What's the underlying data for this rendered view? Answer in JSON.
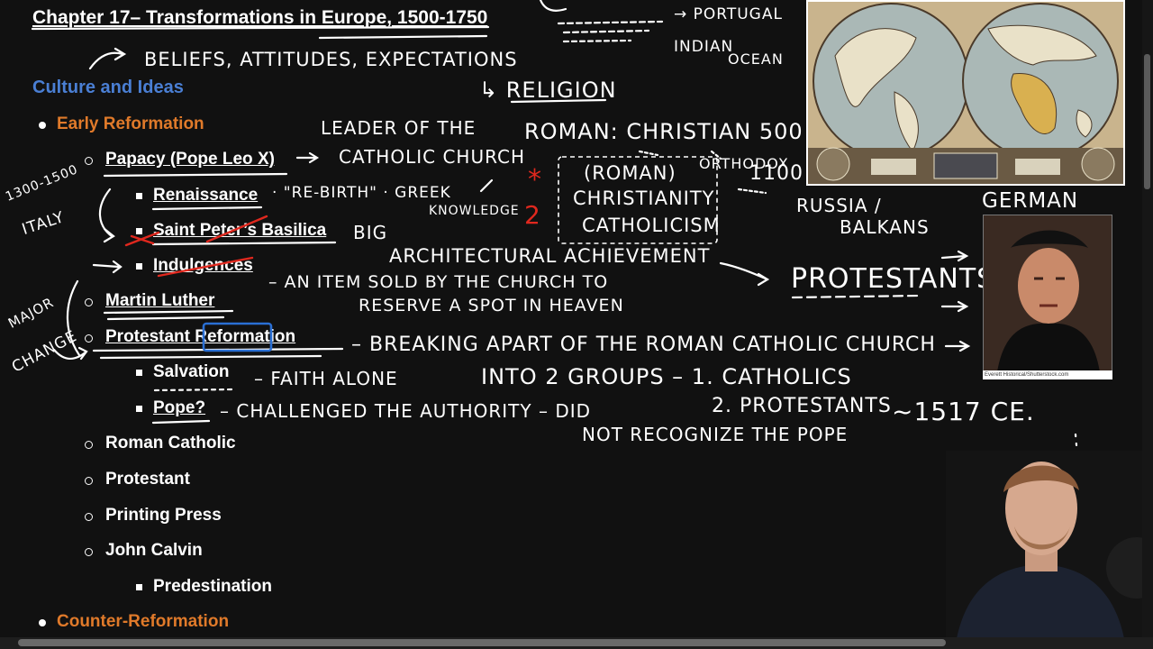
{
  "document": {
    "title": "Chapter 17– Transformations in Europe, 1500-1750",
    "section_heading": "Culture and Ideas",
    "colors": {
      "section": "#4a7fd4",
      "level1": "#e07a2a",
      "text": "#ffffff",
      "background": "#111111",
      "annotation_red": "#e0281e",
      "highlight_box": "#2a6fd4"
    },
    "outline": {
      "early_reformation": "Early Reformation",
      "papacy": "Papacy (Pope Leo X)",
      "renaissance": "Renaissance",
      "saint_peters": "Saint Peter’s Basilica",
      "indulgences": "Indulgences",
      "martin_luther": "Martin Luther",
      "protestant_reformation": "Protestant Reformation",
      "salvation": "Salvation",
      "pope_q": "Pope?",
      "roman_catholic": "Roman Catholic",
      "protestant": "Protestant",
      "printing_press": "Printing Press",
      "john_calvin": "John Calvin",
      "predestination": "Predestination",
      "counter_reformation": "Counter-Reformation"
    }
  },
  "annotations": {
    "beliefs": "BELIEFS, ATTITUDES, EXPECTATIONS",
    "portugal": "→ PORTUGAL",
    "indian": "INDIAN",
    "ocean": "OCEAN",
    "religion": "↳ RELIGION",
    "leader_1": "LEADER OF THE",
    "leader_2": "CATHOLIC CHURCH",
    "roman_christian": "ROMAN: CHRISTIAN 500",
    "orthodox": "ORTHODOX",
    "y1100": "1100",
    "star": "*",
    "two_red": "2",
    "boxed_1": "(ROMAN)",
    "boxed_2": "CHRISTIANITY",
    "boxed_3": "CATHOLICISM",
    "russia": "RUSSIA /",
    "balkans": "BALKANS",
    "german": "GERMAN",
    "years": "1300-1500",
    "italy": "ITALY",
    "rebirth": "· \"RE-BIRTH\" · GREEK",
    "knowledge": "KNOWLEDGE",
    "big": "BIG",
    "architectural": "ARCHITECTURAL ACHIEVEMENT",
    "protestants_big": "PROTESTANTS",
    "item_1": "– AN ITEM SOLD BY THE CHURCH TO",
    "item_2": "RESERVE A SPOT IN HEAVEN",
    "major": "MAJOR",
    "change": "CHANGE",
    "breaking": "– BREAKING APART OF THE ROMAN CATHOLIC CHURCH",
    "faith": "– FAITH ALONE",
    "into": "INTO 2 GROUPS – 1. CATHOLICS",
    "two_prot": "2. PROTESTANTS",
    "c1517": "~1517 CE.",
    "challenged": "– CHALLENGED THE AUTHORITY – DID",
    "not_recognize": "NOT RECOGNIZE THE POPE"
  },
  "images": {
    "credit": "Everett Historical/Shutterstock.com"
  }
}
